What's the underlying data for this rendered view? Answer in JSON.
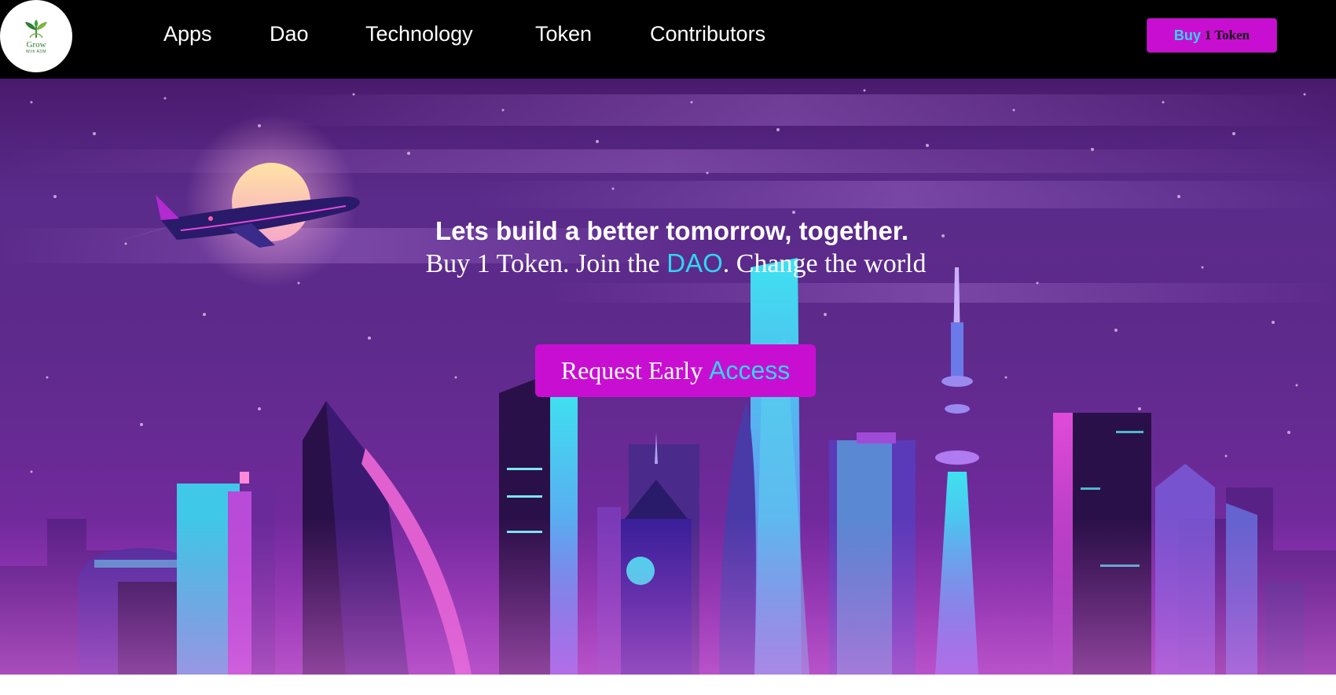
{
  "brand": {
    "logo_icon": "sprout-icon",
    "name": "Grow",
    "tagline": "With ADM"
  },
  "nav": {
    "items": [
      {
        "label": "Apps"
      },
      {
        "label": "Dao"
      },
      {
        "label": "Technology"
      },
      {
        "label": "Token"
      },
      {
        "label": "Contributors"
      }
    ],
    "buy_button": {
      "part1": "Buy",
      "part2": "1 Token"
    }
  },
  "hero": {
    "title": "Lets build a better tomorrow, together.",
    "subtitle": {
      "part1": "Buy 1 Token. Join the ",
      "accent": "DAO",
      "part2": ". Change the world"
    },
    "cta": {
      "part1": "Request Early",
      "part2": "Access"
    }
  },
  "colors": {
    "navbar_bg": "#000000",
    "accent_magenta": "#c80fd1",
    "accent_cyan": "#2fd6f2",
    "hero_purple": "#5e2a8c"
  }
}
